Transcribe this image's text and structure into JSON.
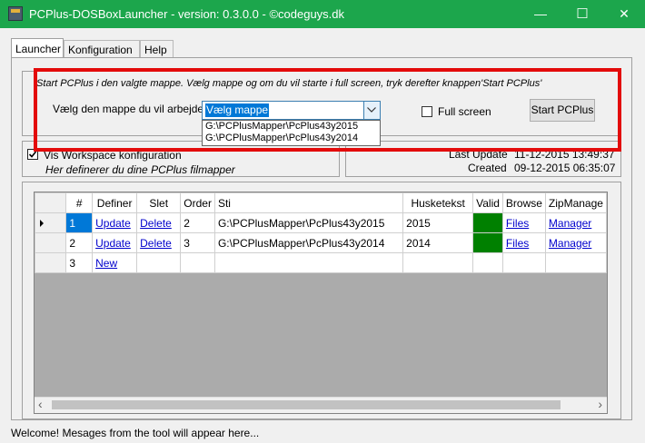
{
  "window": {
    "title": "PCPlus-DOSBoxLauncher - version: 0.3.0.0 - ©codeguys.dk",
    "minimize": "—",
    "maximize": "☐",
    "close": "✕"
  },
  "tabs": [
    {
      "label": "Launcher",
      "active": true
    },
    {
      "label": "Konfiguration",
      "active": false
    },
    {
      "label": "Help",
      "active": false
    }
  ],
  "launcher": {
    "instruction": "Start PCPlus i den valgte mappe. Vælg mappe og om du vil starte i full screen, tryk derefter knappen'Start PCPlus'",
    "folder_label": "Vælg den mappe du vil arbejde i:",
    "folder_value": "Vælg mappe",
    "folder_options": [
      "G:\\PCPlusMapper\\PcPlus43y2015",
      "G:\\PCPlusMapper\\PcPlus43y2014"
    ],
    "fullscreen_label": "Full screen",
    "fullscreen_checked": false,
    "start_button": "Start PCPlus"
  },
  "workspace": {
    "checkbox_label": "Vis Workspace konfiguration",
    "checked": true,
    "description": "Her definerer du dine PCPlus filmapper"
  },
  "info": {
    "last_update_label": "Last Update",
    "last_update_value": "11-12-2015 13:49:37",
    "created_label": "Created",
    "created_value": "09-12-2015 06:35:07"
  },
  "grid": {
    "columns": [
      "#",
      "Definer",
      "Slet",
      "Order",
      "Sti",
      "Husketekst",
      "Valid",
      "Browse",
      "ZipManage"
    ],
    "rows": [
      {
        "current": true,
        "num": "1",
        "definer": "Update",
        "slet": "Delete",
        "order": "2",
        "sti": "G:\\PCPlusMapper\\PcPlus43y2015",
        "husketekst": "2015",
        "valid": true,
        "browse": "Files",
        "zip": "Manager"
      },
      {
        "current": false,
        "num": "2",
        "definer": "Update",
        "slet": "Delete",
        "order": "3",
        "sti": "G:\\PCPlusMapper\\PcPlus43y2014",
        "husketekst": "2014",
        "valid": true,
        "browse": "Files",
        "zip": "Manager"
      },
      {
        "current": false,
        "num": "3",
        "definer": "New",
        "slet": "",
        "order": "",
        "sti": "",
        "husketekst": "",
        "valid": false,
        "browse": "",
        "zip": ""
      }
    ],
    "scroll_left": "‹",
    "scroll_right": "›"
  },
  "status": {
    "message": "Welcome! Mesages from the tool will appear here..."
  }
}
